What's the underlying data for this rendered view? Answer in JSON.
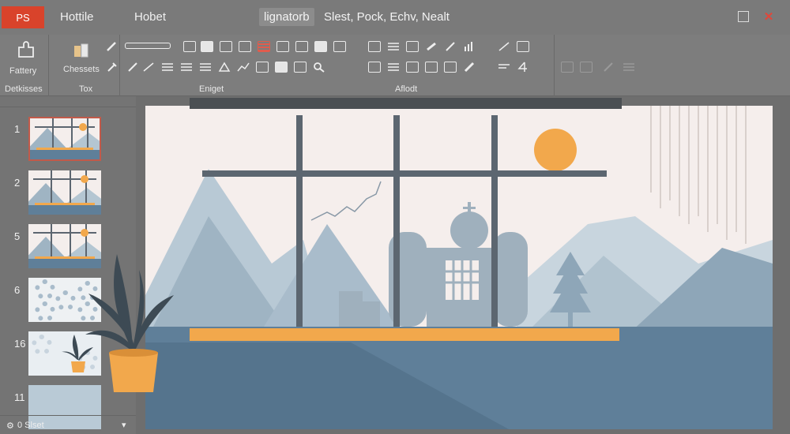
{
  "app": {
    "badge": "PS",
    "title_pill": "lignatorb",
    "title_rest": "Slest, Pock, Echv, Nealt"
  },
  "menu": {
    "items": [
      "Hottile",
      "Hobet"
    ]
  },
  "ribbon": {
    "gallery_label_1": "Fattery",
    "gallery_label_2": "Detkisses",
    "chessets_label": "Chessets",
    "groups": [
      {
        "label": "Tox"
      },
      {
        "label": "Eniget"
      },
      {
        "label": "Aflodt"
      }
    ]
  },
  "slides_panel": {
    "slides": [
      {
        "number": "1",
        "active": true,
        "kind": "landscape"
      },
      {
        "number": "2",
        "active": false,
        "kind": "landscape"
      },
      {
        "number": "5",
        "active": false,
        "kind": "landscape"
      },
      {
        "number": "6",
        "active": false,
        "kind": "gears"
      },
      {
        "number": "16",
        "active": false,
        "kind": "plant"
      },
      {
        "number": "11",
        "active": false,
        "kind": "blank"
      }
    ],
    "footer": "0 Slset"
  },
  "colors": {
    "accent": "#d9432b",
    "sun": "#f2a84c",
    "sky": "#f5eeec",
    "mountain_dark": "#8ea6b8",
    "mountain_light": "#b8c9d5",
    "ground": "#5f7f99",
    "frame": "#5c6670"
  },
  "icons": {
    "close": "close-icon",
    "restore": "restore-icon",
    "search": "search-icon"
  }
}
